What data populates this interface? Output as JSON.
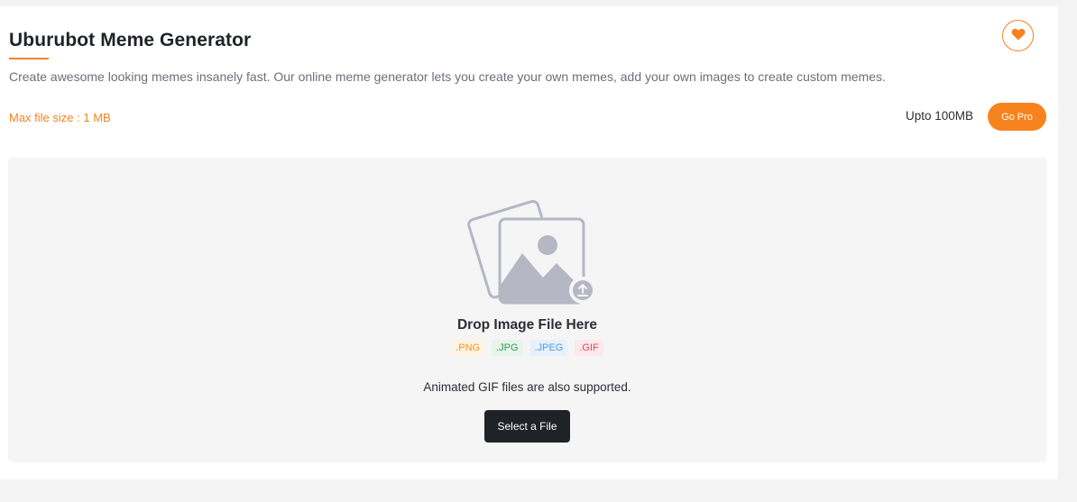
{
  "header": {
    "title": "Uburubot Meme Generator",
    "description": "Create awesome looking memes insanely fast. Our online meme generator lets you create your own memes, add your own images to create custom memes.",
    "favorite_icon": "heart-icon"
  },
  "limits": {
    "max_file_size": "Max file size : 1 MB",
    "upto": "Upto 100MB",
    "go_pro_label": "Go Pro"
  },
  "dropzone": {
    "illustration_icon": "image-upload-icon",
    "title": "Drop Image File Here",
    "formats": [
      ".PNG",
      ".JPG",
      ".JPEG",
      ".GIF"
    ],
    "gif_note": "Animated GIF files are also supported.",
    "select_label": "Select a File"
  },
  "colors": {
    "accent": "#f7831e",
    "dark_button": "#1f2226",
    "dropzone_bg": "#f5f5f6",
    "illustration": "#b5b7c4"
  }
}
